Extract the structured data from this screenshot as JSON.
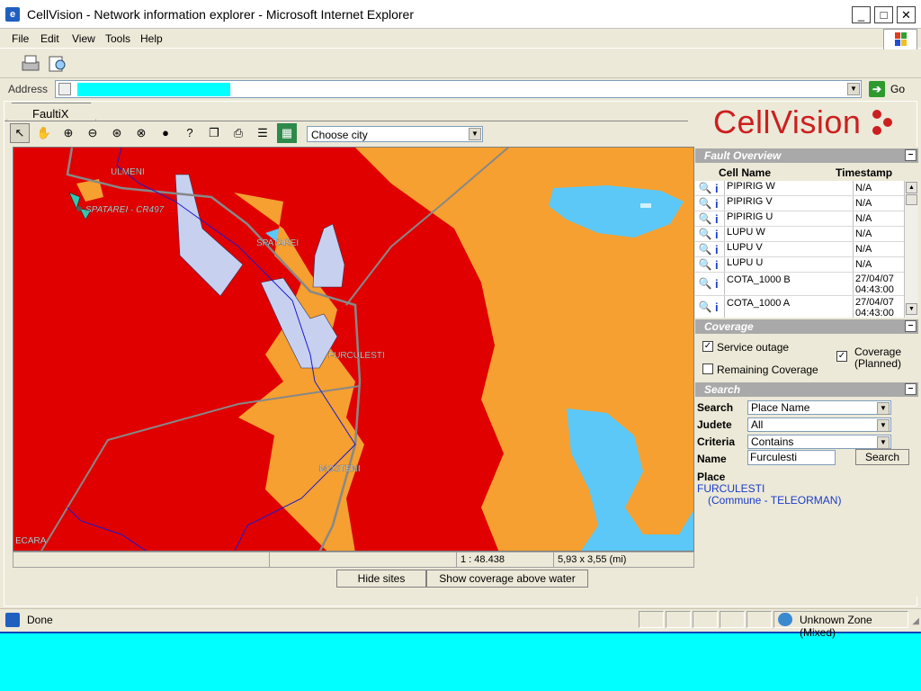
{
  "window": {
    "title": "CellVision - Network information explorer - Microsoft Internet Explorer",
    "icon": "ie-icon",
    "controls": [
      "minimize",
      "maximize",
      "close"
    ]
  },
  "menu": [
    "File",
    "Edit",
    "View",
    "Tools",
    "Help"
  ],
  "address": {
    "label": "Address",
    "value": "",
    "go_label": "Go"
  },
  "app": {
    "tab_label": "FaultiX",
    "logo": "CellVision",
    "city_select": {
      "value": "Choose city"
    },
    "tools": [
      "pointer",
      "pan",
      "zoom-in",
      "zoom-out",
      "zoom-previous",
      "zoom-extent",
      "circle",
      "help",
      "copy",
      "print",
      "legend",
      "overview"
    ]
  },
  "map": {
    "labels": [
      "ULMENI",
      "SPATAREI - CR497",
      "SPATAREI",
      "FURCULESTI",
      "MOSTENI",
      "ECARA"
    ],
    "scale": "1 : 48.438",
    "extent": "5,93 x 3,55 (mi)"
  },
  "buttons": {
    "hide_sites": "Hide sites",
    "show_coverage": "Show coverage above water"
  },
  "fault_overview": {
    "title": "Fault Overview",
    "columns": [
      "Cell Name",
      "Timestamp"
    ],
    "rows": [
      {
        "name": "PIPIRIG W",
        "ts": "N/A"
      },
      {
        "name": "PIPIRIG V",
        "ts": "N/A"
      },
      {
        "name": "PIPIRIG U",
        "ts": "N/A"
      },
      {
        "name": "LUPU W",
        "ts": "N/A"
      },
      {
        "name": "LUPU V",
        "ts": "N/A"
      },
      {
        "name": "LUPU U",
        "ts": "N/A"
      },
      {
        "name": "COTA_1000 B",
        "ts": "27/04/07 04:43:00"
      },
      {
        "name": "COTA_1000 A",
        "ts": "27/04/07 04:43:00"
      }
    ]
  },
  "coverage": {
    "title": "Coverage",
    "service_outage": {
      "label": "Service outage",
      "checked": true
    },
    "remaining": {
      "label": "Remaining Coverage",
      "checked": false
    },
    "planned": {
      "label1": "Coverage",
      "label2": "(Planned)",
      "checked": true
    }
  },
  "search": {
    "title": "Search",
    "search_label": "Search",
    "search_value": "Place Name",
    "judete_label": "Judete",
    "judete_value": "All",
    "criteria_label": "Criteria",
    "criteria_value": "Contains",
    "name_label": "Name",
    "name_value": "Furculesti",
    "button": "Search",
    "result_header": "Place",
    "result_place": "FURCULESTI",
    "result_detail": "(Commune - TELEORMAN)"
  },
  "status": {
    "text": "Done",
    "zone": "Unknown Zone (Mixed)"
  },
  "colors": {
    "outage": "#e00000",
    "coverage": "#f5a030",
    "water": "#5cc8f8",
    "planned": "#c8d0f0"
  }
}
